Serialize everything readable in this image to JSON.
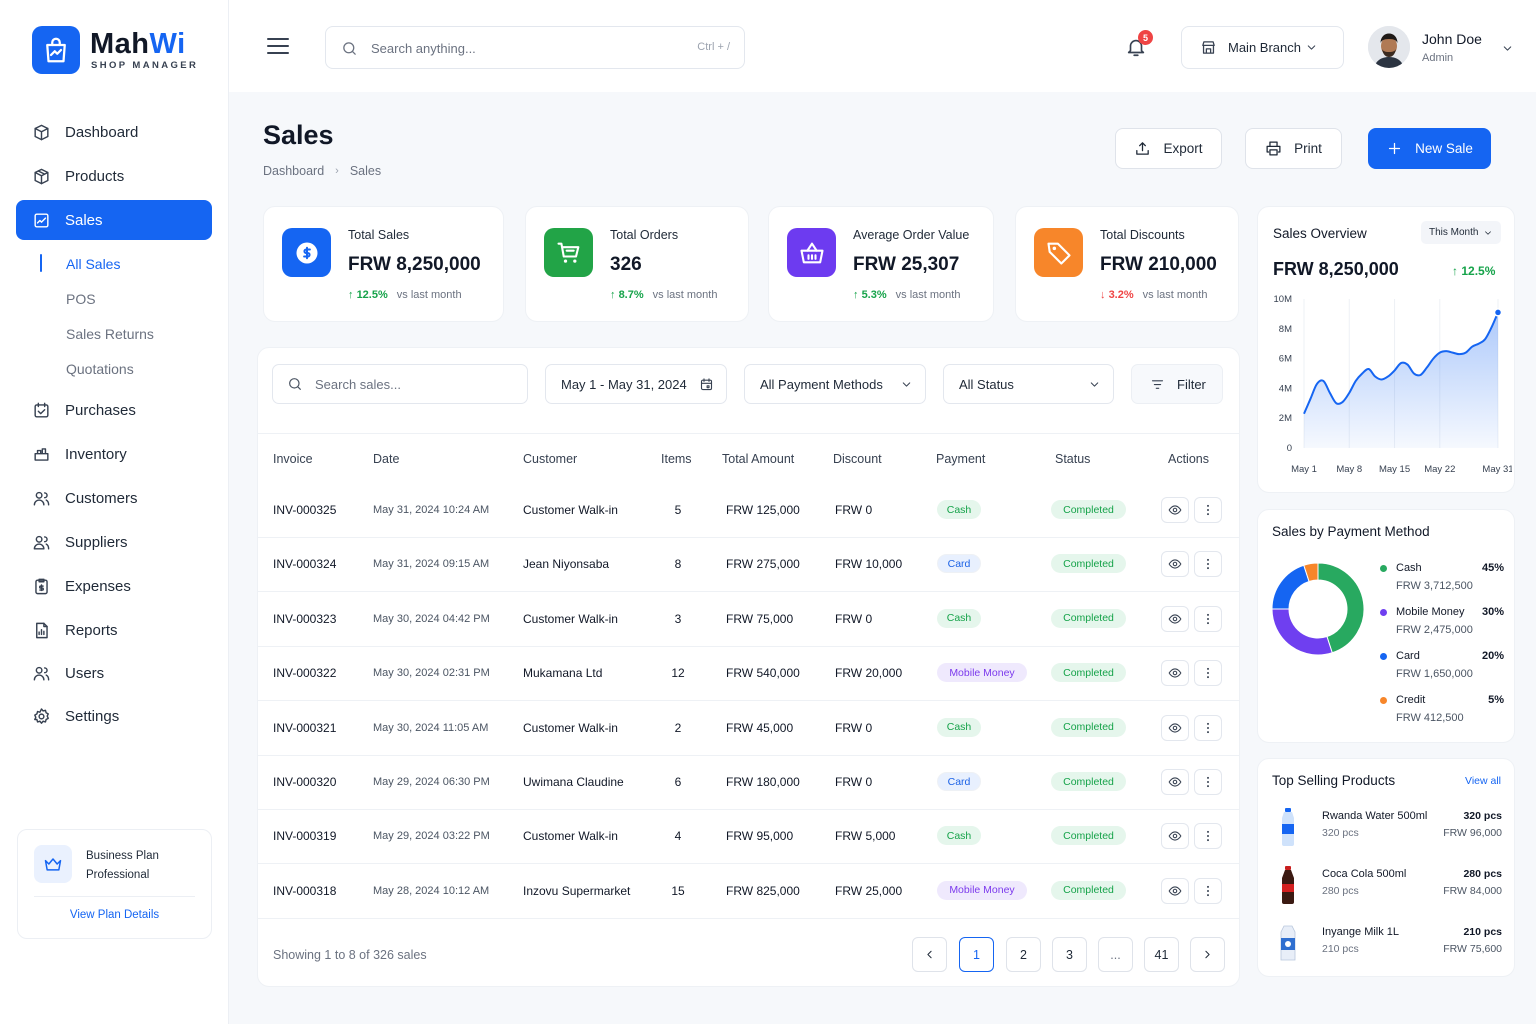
{
  "brand": {
    "name_a": "Mah",
    "name_b": "Wi",
    "subtitle": "SHOP MANAGER"
  },
  "sidebar": {
    "items": [
      {
        "label": "Dashboard",
        "icon": "dashboard-icon"
      },
      {
        "label": "Products",
        "icon": "box-icon"
      },
      {
        "label": "Sales",
        "icon": "sales-chart-icon",
        "active": true
      },
      {
        "label": "Purchases",
        "icon": "purchases-icon"
      },
      {
        "label": "Inventory",
        "icon": "inventory-icon"
      },
      {
        "label": "Customers",
        "icon": "customers-icon"
      },
      {
        "label": "Suppliers",
        "icon": "suppliers-icon"
      },
      {
        "label": "Expenses",
        "icon": "expenses-icon"
      },
      {
        "label": "Reports",
        "icon": "reports-icon"
      },
      {
        "label": "Users",
        "icon": "users-icon"
      },
      {
        "label": "Settings",
        "icon": "settings-gear-icon"
      }
    ],
    "sub_items": [
      "All Sales",
      "POS",
      "Sales Returns",
      "Quotations"
    ],
    "plan": {
      "line1": "Business Plan",
      "line2": "Professional",
      "link": "View Plan Details"
    }
  },
  "topbar": {
    "search_placeholder": "Search anything...",
    "shortcut": "Ctrl + /",
    "notification_count": "5",
    "branch": "Main Branch",
    "user_name": "John Doe",
    "user_role": "Admin"
  },
  "page": {
    "title": "Sales",
    "breadcrumb": [
      "Dashboard",
      "Sales"
    ],
    "buttons": {
      "export": "Export",
      "print": "Print",
      "new_sale": "New Sale"
    }
  },
  "stats": [
    {
      "label": "Total Sales",
      "value": "FRW 8,250,000",
      "delta": "12.5%",
      "direction": "up",
      "note": "vs last month",
      "color": "#1565f2",
      "icon": "dollar-icon"
    },
    {
      "label": "Total Orders",
      "value": "326",
      "delta": "8.7%",
      "direction": "up",
      "note": "vs last month",
      "color": "#22a447",
      "icon": "cart-icon"
    },
    {
      "label": "Average Order Value",
      "value": "FRW 25,307",
      "delta": "5.3%",
      "direction": "up",
      "note": "vs last month",
      "color": "#6d3bf0",
      "icon": "basket-icon"
    },
    {
      "label": "Total Discounts",
      "value": "FRW 210,000",
      "delta": "3.2%",
      "direction": "down",
      "note": "vs last month",
      "color": "#f7862a",
      "icon": "tag-icon"
    }
  ],
  "filters": {
    "search_placeholder": "Search sales...",
    "date_range": "May 1 - May 31, 2024",
    "payment": "All Payment Methods",
    "status": "All Status",
    "filter_label": "Filter"
  },
  "table": {
    "columns": [
      "Invoice",
      "Date",
      "Customer",
      "Items",
      "Total Amount",
      "Discount",
      "Payment",
      "Status",
      "Actions"
    ],
    "rows": [
      {
        "invoice": "INV-000325",
        "date": "May 31, 2024 10:24 AM",
        "customer": "Customer Walk-in",
        "items": "5",
        "total": "FRW 125,000",
        "discount": "FRW 0",
        "payment": "Cash",
        "status": "Completed"
      },
      {
        "invoice": "INV-000324",
        "date": "May 31, 2024 09:15 AM",
        "customer": "Jean Niyonsaba",
        "items": "8",
        "total": "FRW 275,000",
        "discount": "FRW 10,000",
        "payment": "Card",
        "status": "Completed"
      },
      {
        "invoice": "INV-000323",
        "date": "May 30, 2024 04:42 PM",
        "customer": "Customer Walk-in",
        "items": "3",
        "total": "FRW 75,000",
        "discount": "FRW 0",
        "payment": "Cash",
        "status": "Completed"
      },
      {
        "invoice": "INV-000322",
        "date": "May 30, 2024 02:31 PM",
        "customer": "Mukamana Ltd",
        "items": "12",
        "total": "FRW 540,000",
        "discount": "FRW 20,000",
        "payment": "Mobile Money",
        "status": "Completed"
      },
      {
        "invoice": "INV-000321",
        "date": "May 30, 2024 11:05 AM",
        "customer": "Customer Walk-in",
        "items": "2",
        "total": "FRW 45,000",
        "discount": "FRW 0",
        "payment": "Cash",
        "status": "Completed"
      },
      {
        "invoice": "INV-000320",
        "date": "May 29, 2024 06:30 PM",
        "customer": "Uwimana Claudine",
        "items": "6",
        "total": "FRW 180,000",
        "discount": "FRW 0",
        "payment": "Card",
        "status": "Completed"
      },
      {
        "invoice": "INV-000319",
        "date": "May 29, 2024 03:22 PM",
        "customer": "Customer Walk-in",
        "items": "4",
        "total": "FRW 95,000",
        "discount": "FRW 5,000",
        "payment": "Cash",
        "status": "Completed"
      },
      {
        "invoice": "INV-000318",
        "date": "May 28, 2024 10:12 AM",
        "customer": "Inzovu Supermarket",
        "items": "15",
        "total": "FRW 825,000",
        "discount": "FRW 25,000",
        "payment": "Mobile Money",
        "status": "Completed"
      }
    ],
    "footer": "Showing 1 to 8 of 326 sales",
    "pages": [
      "1",
      "2",
      "3",
      "...",
      "41"
    ],
    "current_page": "1"
  },
  "overview": {
    "title": "Sales Overview",
    "period": "This Month",
    "total": "FRW 8,250,000",
    "delta": "12.5%"
  },
  "chart_data": {
    "type": "area",
    "x": [
      "May 1",
      "May 2",
      "May 3",
      "May 4",
      "May 5",
      "May 6",
      "May 7",
      "May 8",
      "May 9",
      "May 10",
      "May 11",
      "May 12",
      "May 13",
      "May 14",
      "May 15",
      "May 16",
      "May 17",
      "May 18",
      "May 19",
      "May 20",
      "May 21",
      "May 22",
      "May 23",
      "May 24",
      "May 25",
      "May 26",
      "May 27",
      "May 28",
      "May 29",
      "May 30",
      "May 31"
    ],
    "x_ticks": [
      "May 1",
      "May 8",
      "May 15",
      "May 22",
      "May 31"
    ],
    "y_ticks": [
      "0",
      "2M",
      "4M",
      "6M",
      "8M",
      "10M"
    ],
    "ylim": [
      0,
      10000000
    ],
    "values": [
      2300000,
      3300000,
      4300000,
      4500000,
      3700000,
      3000000,
      3100000,
      3700000,
      4500000,
      5000000,
      5300000,
      4800000,
      4600000,
      4800000,
      5200000,
      5700000,
      5600000,
      5000000,
      4900000,
      5400000,
      6000000,
      6400000,
      6500000,
      6400000,
      6300000,
      6400000,
      6800000,
      7000000,
      7300000,
      8100000,
      9100000
    ],
    "title": "Sales Overview",
    "grid": "vertical",
    "color": "#1565f2"
  },
  "payment_methods": {
    "title": "Sales by Payment Method",
    "items": [
      {
        "name": "Cash",
        "percent": "45%",
        "amount": "FRW 3,712,500",
        "color": "#28a960",
        "share": 45
      },
      {
        "name": "Mobile Money",
        "percent": "30%",
        "amount": "FRW 2,475,000",
        "color": "#6f3ff0",
        "share": 30
      },
      {
        "name": "Card",
        "percent": "20%",
        "amount": "FRW 1,650,000",
        "color": "#1565f2",
        "share": 20
      },
      {
        "name": "Credit",
        "percent": "5%",
        "amount": "FRW 412,500",
        "color": "#f7862a",
        "share": 5
      }
    ]
  },
  "top_products": {
    "title": "Top Selling Products",
    "view_all": "View all",
    "items": [
      {
        "name": "Rwanda Water 500ml",
        "sold": "320 pcs",
        "qty": "320 pcs",
        "value": "FRW 96,000",
        "icon": "water-bottle-icon"
      },
      {
        "name": "Coca Cola 500ml",
        "sold": "280 pcs",
        "qty": "280 pcs",
        "value": "FRW 84,000",
        "icon": "soda-bottle-icon"
      },
      {
        "name": "Inyange Milk 1L",
        "sold": "210 pcs",
        "qty": "210 pcs",
        "value": "FRW 75,600",
        "icon": "milk-carton-icon"
      }
    ]
  }
}
